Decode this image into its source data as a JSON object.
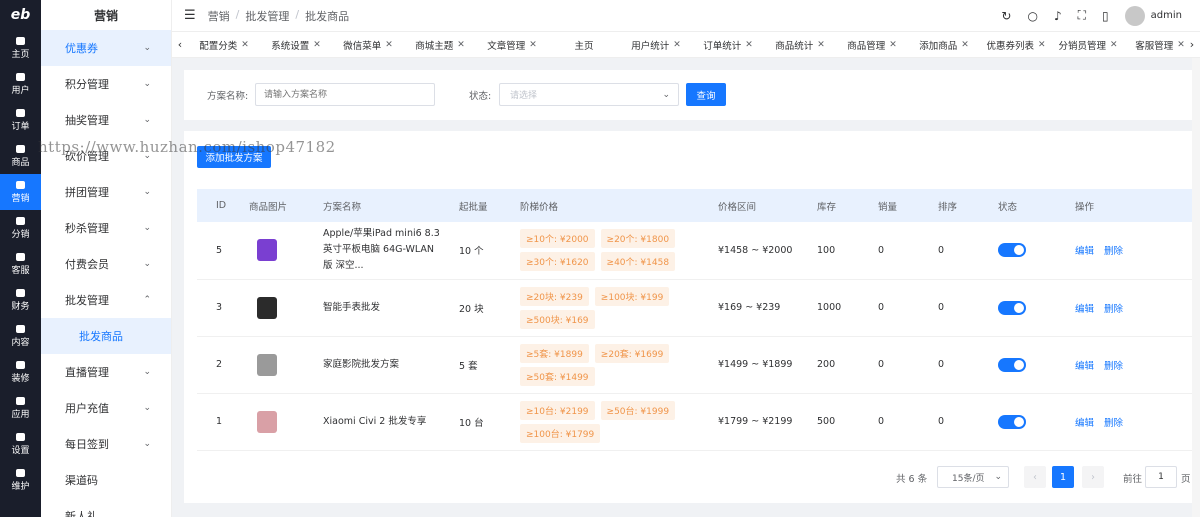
{
  "rail": {
    "logo": "eb",
    "items": [
      "主页",
      "用户",
      "订单",
      "商品",
      "营销",
      "分销",
      "客服",
      "财务",
      "内容",
      "装修",
      "应用",
      "设置",
      "维护"
    ]
  },
  "sidebar": {
    "title": "营销",
    "items": [
      "优惠券",
      "积分管理",
      "抽奖管理",
      "砍价管理",
      "拼团管理",
      "秒杀管理",
      "付费会员",
      "批发管理"
    ],
    "sub_item": "批发商品",
    "items_after": [
      "直播管理",
      "用户充值",
      "每日签到",
      "渠道码",
      "新人礼"
    ]
  },
  "header": {
    "breadcrumb": [
      "营销",
      "批发管理",
      "批发商品"
    ],
    "user": "admin"
  },
  "tabs": [
    "配置分类",
    "系统设置",
    "微信菜单",
    "商城主题",
    "文章管理",
    "主页",
    "用户统计",
    "订单统计",
    "商品统计",
    "商品管理",
    "添加商品",
    "优惠券列表",
    "分销员管理",
    "客服管理"
  ],
  "filter": {
    "name_label": "方案名称:",
    "name_placeholder": "请输入方案名称",
    "status_label": "状态:",
    "status_placeholder": "请选择",
    "query_button": "查询"
  },
  "add_button": "添加批发方案",
  "watermark": "https://www.huzhan.com/ishop47182",
  "table": {
    "headers": [
      "ID",
      "商品图片",
      "方案名称",
      "起批量",
      "阶梯价格",
      "价格区间",
      "库存",
      "销量",
      "排序",
      "状态",
      "操作"
    ],
    "rows": [
      {
        "id": "5",
        "name": "Apple/苹果iPad mini6 8.3英寸平板电脑 64G-WLAN版 深空...",
        "min": "10 个",
        "tiers": [
          "≥10个: ¥2000",
          "≥20个: ¥1800",
          "≥30个: ¥1620",
          "≥40个: ¥1458"
        ],
        "range": "¥1458 ~ ¥2000",
        "stock": "100",
        "sales": "0",
        "sort": "0",
        "img": "#7a3fd1"
      },
      {
        "id": "3",
        "name": "智能手表批发",
        "min": "20 块",
        "tiers": [
          "≥20块: ¥239",
          "≥100块: ¥199",
          "≥500块: ¥169"
        ],
        "range": "¥169 ~ ¥239",
        "stock": "1000",
        "sales": "0",
        "sort": "0",
        "img": "#2b2b2b"
      },
      {
        "id": "2",
        "name": "家庭影院批发方案",
        "min": "5 套",
        "tiers": [
          "≥5套: ¥1899",
          "≥20套: ¥1699",
          "≥50套: ¥1499"
        ],
        "range": "¥1499 ~ ¥1899",
        "stock": "200",
        "sales": "0",
        "sort": "0",
        "img": "#9a9a9a"
      },
      {
        "id": "1",
        "name": "Xiaomi Civi 2 批发专享",
        "min": "10 台",
        "tiers": [
          "≥10台: ¥2199",
          "≥50台: ¥1999",
          "≥100台: ¥1799"
        ],
        "range": "¥1799 ~ ¥2199",
        "stock": "500",
        "sales": "0",
        "sort": "0",
        "img": "#d9a0a6"
      }
    ],
    "edit_label": "编辑",
    "delete_label": "删除"
  },
  "pager": {
    "total": "共 6 条",
    "page_size": "15条/页",
    "current": "1",
    "goto_label": "前往",
    "goto_value": "1",
    "page_suffix": "页"
  }
}
